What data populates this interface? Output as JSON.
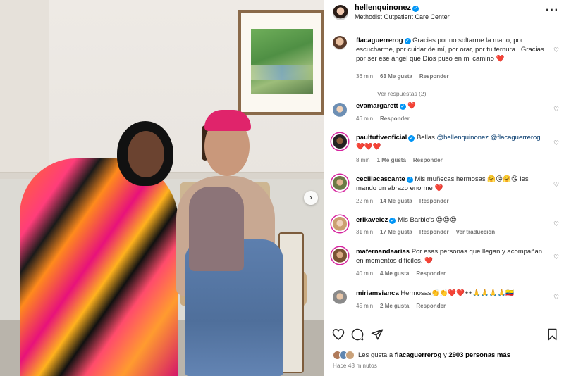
{
  "post": {
    "username": "hellenquinonez",
    "location": "Methodist Outpatient Care Center",
    "verified": true,
    "more_icon": "more-horizontal-icon"
  },
  "carousel": {
    "next_icon": "chevron-right-icon",
    "next_glyph": "›"
  },
  "comments": [
    {
      "username": "flacaguerrerog",
      "verified": true,
      "text": "Gracias por no soltarme la mano, por escucharme, por cuidar de mí, por orar, por tu ternura.. Gracias por ser ese ángel que Dios puso en mi camino",
      "emoji": "❤️",
      "time": "36 min",
      "likes": "63 Me gusta",
      "reply": "Responder",
      "view_replies": "Ver respuestas (2)"
    },
    {
      "username": "evamargarett",
      "verified": true,
      "text": "",
      "emoji": "❤️",
      "time": "46 min",
      "reply": "Responder"
    },
    {
      "username": "paultutiveoficial",
      "verified": true,
      "text": "Bellas",
      "mention1": "@hellenquinonez",
      "mention2": "@flacaguerrerog",
      "emoji": "❤️❤️❤️",
      "time": "8 min",
      "likes": "1 Me gusta",
      "reply": "Responder"
    },
    {
      "username": "ceciliacascante",
      "verified": true,
      "text": "Mis muñecas hermosas",
      "emoji_mid": "🤗😘🤗😘",
      "text2": "les mando un abrazo enorme",
      "emoji": "❤️",
      "time": "22 min",
      "likes": "14 Me gusta",
      "reply": "Responder"
    },
    {
      "username": "erikavelez",
      "verified": true,
      "text": "Mis Barbie's",
      "emoji": "😍😍😍",
      "time": "31 min",
      "likes": "17 Me gusta",
      "reply": "Responder",
      "translate": "Ver traducción"
    },
    {
      "username": "mafernandaarias",
      "verified": false,
      "text": "Por esas personas que llegan y acompañan en momentos difíciles.",
      "emoji": "❤️",
      "time": "40 min",
      "likes": "4 Me gusta",
      "reply": "Responder"
    },
    {
      "username": "miriamsianca",
      "verified": false,
      "text": "Hermosas👏👏❤️❤️++🙏🙏🙏🙏🇪🇨",
      "time": "45 min",
      "likes": "2 Me gusta",
      "reply": "Responder"
    }
  ],
  "footer": {
    "like_icon": "heart-outline-icon",
    "comment_icon": "comment-icon",
    "share_icon": "share-icon",
    "save_icon": "bookmark-icon",
    "likes_prefix": "Les gusta a",
    "likes_user": "flacaguerrerog",
    "likes_mid": "y",
    "likes_count": "2903 personas más",
    "posted_ago": "Hace 48 minutos"
  },
  "colors": {
    "verified": "#0095f6",
    "mention": "#00376b",
    "meta": "#737373",
    "heart": "#e0245e"
  }
}
